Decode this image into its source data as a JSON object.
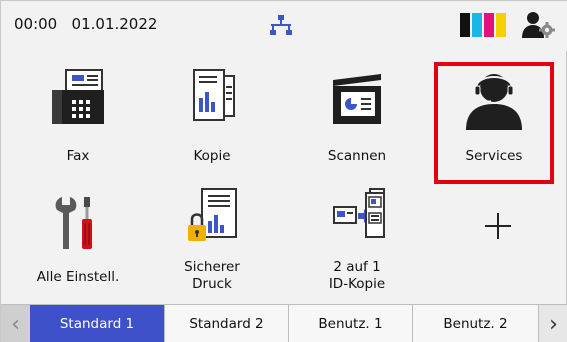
{
  "status": {
    "time": "00:00",
    "date": "01.01.2022",
    "network_icon": "wired-network-icon",
    "ink_icon": "ink-level-icon",
    "user_icon": "user-settings-icon",
    "ink_colors": [
      "#111111",
      "#18b7e8",
      "#e0137a",
      "#f4d200"
    ]
  },
  "tiles": [
    {
      "label": "Fax",
      "icon": "fax-icon"
    },
    {
      "label": "Kopie",
      "icon": "copy-icon"
    },
    {
      "label": "Scannen",
      "icon": "scanner-icon"
    },
    {
      "label": "Services",
      "icon": "headset-person-icon"
    },
    {
      "label": "Alle Einstell.",
      "icon": "tools-icon"
    },
    {
      "label": "Sicherer\nDruck",
      "icon": "secure-print-icon"
    },
    {
      "label": "2 auf 1\nID-Kopie",
      "icon": "id-copy-icon"
    },
    {
      "label": "+",
      "icon": "add-icon"
    }
  ],
  "highlight_color": "#e0000f",
  "tabs": [
    {
      "label": "Standard 1",
      "active": true
    },
    {
      "label": "Standard 2",
      "active": false
    },
    {
      "label": "Benutz. 1",
      "active": false
    },
    {
      "label": "Benutz. 2",
      "active": false
    }
  ],
  "nav": {
    "prev": "‹",
    "next": "›"
  },
  "accent_color": "#3f51c8"
}
